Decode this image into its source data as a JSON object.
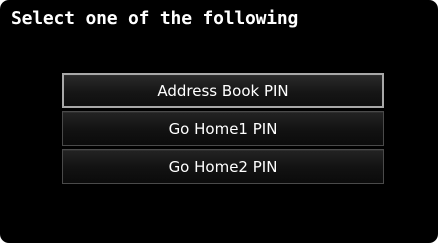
{
  "screen": {
    "title": "Select one of the following"
  },
  "menu": {
    "items": [
      {
        "label": "Address Book PIN",
        "selected": true
      },
      {
        "label": "Go Home1 PIN",
        "selected": false
      },
      {
        "label": "Go Home2 PIN",
        "selected": false
      }
    ]
  },
  "colors": {
    "background": "#000000",
    "text": "#ffffff",
    "selected_border": "#a8a8a8",
    "item_border": "#4a4a4a"
  }
}
